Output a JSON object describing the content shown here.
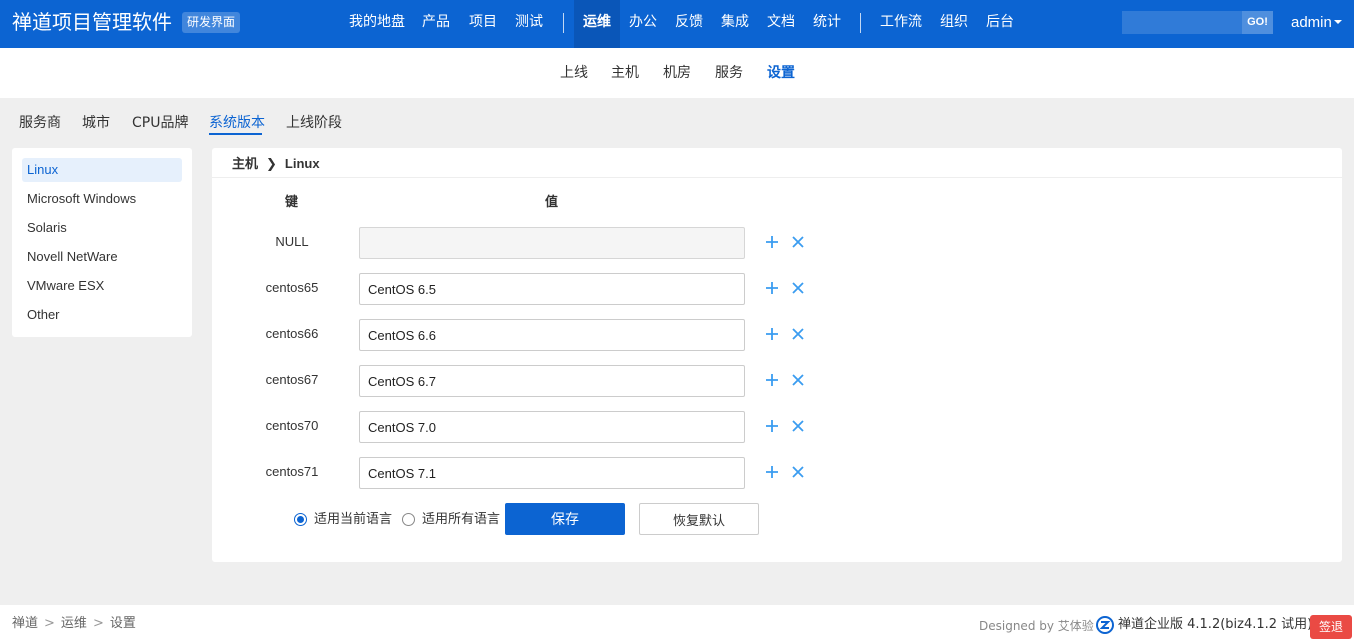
{
  "header": {
    "brand": "禅道项目管理软件",
    "brand_tag": "研发界面",
    "nav": [
      "我的地盘",
      "产品",
      "项目",
      "测试",
      "运维",
      "办公",
      "反馈",
      "集成",
      "文档",
      "统计",
      "工作流",
      "组织",
      "后台"
    ],
    "active_nav": "运维",
    "search_placeholder": "",
    "search_button": "GO!",
    "user": "admin"
  },
  "subnav": {
    "items": [
      "上线",
      "主机",
      "机房",
      "服务",
      "设置"
    ],
    "active": "设置"
  },
  "tabs": {
    "items": [
      "服务商",
      "城市",
      "CPU品牌",
      "系统版本",
      "上线阶段"
    ],
    "active": "系统版本"
  },
  "side": {
    "items": [
      "Linux",
      "Microsoft Windows",
      "Solaris",
      "Novell NetWare",
      "VMware ESX",
      "Other"
    ],
    "active": "Linux"
  },
  "main": {
    "breadcrumb": [
      "主机",
      "Linux"
    ],
    "key_header": "键",
    "value_header": "值",
    "rows": [
      {
        "key": "NULL",
        "value": "",
        "disabled": true
      },
      {
        "key": "centos65",
        "value": "CentOS 6.5",
        "disabled": false
      },
      {
        "key": "centos66",
        "value": "CentOS 6.6",
        "disabled": false
      },
      {
        "key": "centos67",
        "value": "CentOS 6.7",
        "disabled": false
      },
      {
        "key": "centos70",
        "value": "CentOS 7.0",
        "disabled": false
      },
      {
        "key": "centos71",
        "value": "CentOS 7.1",
        "disabled": false
      }
    ],
    "radio_current": "适用当前语言",
    "radio_all": "适用所有语言",
    "radio_selected": "current",
    "save_label": "保存",
    "reset_label": "恢复默认"
  },
  "footer": {
    "crumbs": [
      "禅道",
      "运维",
      "设置"
    ],
    "designed_by": "Designed by 艾体验",
    "version": "禅道企业版 4.1.2(biz4.1.2 试用)",
    "signout": "签退"
  },
  "colors": {
    "primary": "#0c64d2",
    "danger": "#ea4a44",
    "icon_blue": "#3a9cf0"
  }
}
